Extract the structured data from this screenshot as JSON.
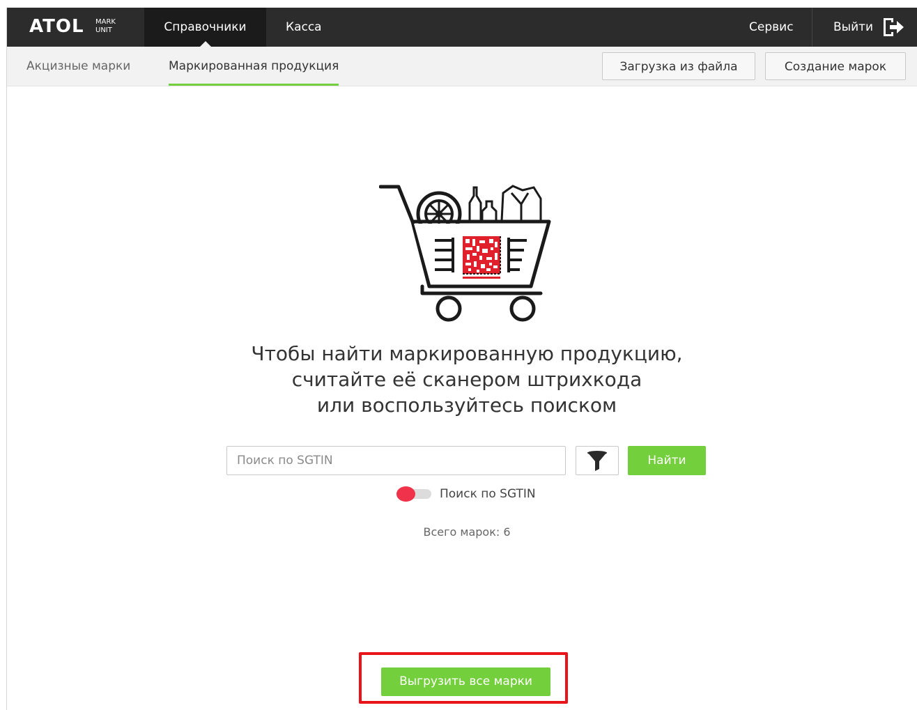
{
  "header": {
    "logo_main": "ATOL",
    "logo_sub_1": "MARK",
    "logo_sub_2": "UNIT",
    "nav": [
      "Справочники",
      "Касса"
    ],
    "service_label": "Сервис",
    "logout_label": "Выйти",
    "logout_icon": "logout-icon"
  },
  "subnav": {
    "tabs": [
      "Акцизные марки",
      "Маркированная продукция"
    ],
    "active_tab": "Маркированная продукция",
    "upload_button": "Загрузка из файла",
    "create_button": "Создание марок"
  },
  "main": {
    "illustration": "shopping-cart-with-datamatrix-icon",
    "headline_lines": [
      "Чтобы найти маркированную продукцию,",
      "считайте её сканером штрихкода",
      "или воспользуйтесь поиском"
    ],
    "search": {
      "placeholder": "Поиск по SGTIN",
      "value": ""
    },
    "filter_icon": "filter-icon",
    "find_button": "Найти",
    "toggle_label": "Поиск по SGTIN",
    "toggle_on": false,
    "count_text": "Всего марок: 6",
    "export_button": "Выгрузить все марки"
  },
  "colors": {
    "header_bg": "#2c2c2c",
    "accent_green": "#73cf3c",
    "toggle_red": "#f0324b",
    "highlight_red": "#e8141a"
  }
}
